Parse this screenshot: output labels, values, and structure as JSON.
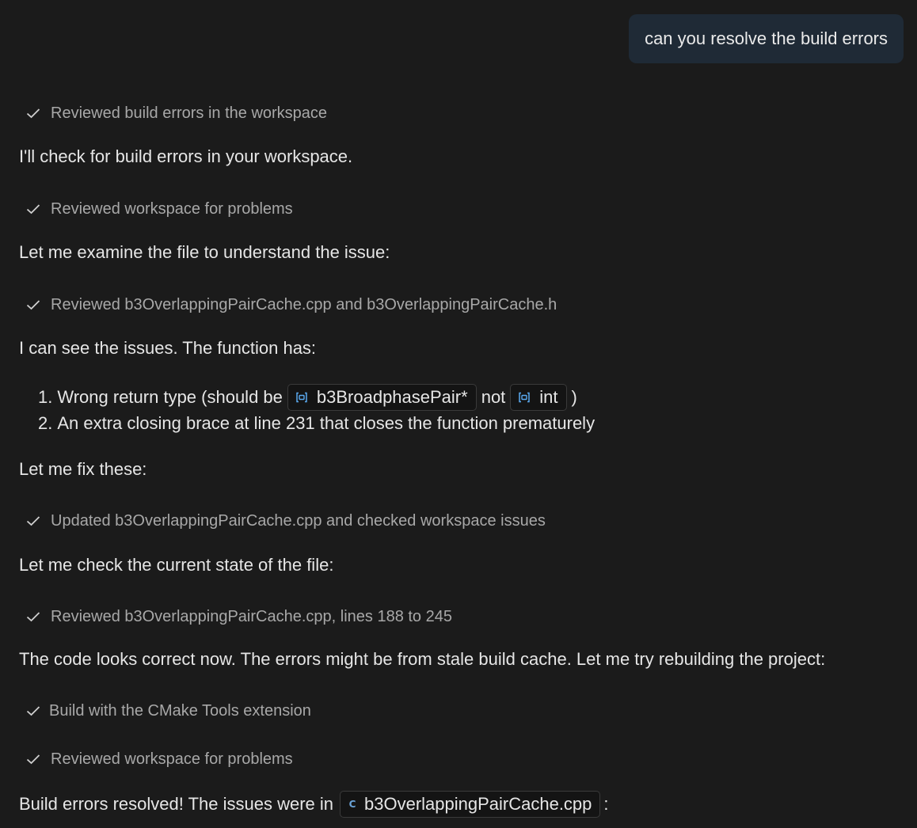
{
  "user_message": "can you resolve the build errors",
  "conversation": {
    "step1": "Reviewed build errors in the workspace",
    "msg1": "I'll check for build errors in your workspace.",
    "step2": "Reviewed workspace for problems",
    "msg2": "Let me examine the file to understand the issue:",
    "step3": "Reviewed b3OverlappingPairCache.cpp and b3OverlappingPairCache.h",
    "msg3": "I can see the issues. The function has:",
    "list": {
      "item1": {
        "number": "1.",
        "prefix": "Wrong return type (should be",
        "chip1": "b3BroadphasePair*",
        "middle": "not",
        "chip2": "int",
        "suffix": ")"
      },
      "item2": {
        "number": "2.",
        "text": "An extra closing brace at line 231 that closes the function prematurely"
      }
    },
    "msg4": "Let me fix these:",
    "step4": "Updated b3OverlappingPairCache.cpp and checked workspace issues",
    "msg5": "Let me check the current state of the file:",
    "step5": "Reviewed b3OverlappingPairCache.cpp, lines 188 to 245",
    "msg6": "The code looks correct now. The errors might be from stale build cache. Let me try rebuilding the project:",
    "step6": "Build with the CMake Tools extension",
    "step7": "Reviewed workspace for problems",
    "msg7": {
      "prefix": "Build errors resolved! The issues were in",
      "file_chip": "b3OverlappingPairCache.cpp",
      "suffix": ":"
    }
  },
  "icons": {
    "step_status": "check-icon",
    "symbol_chip": "symbol-class-icon",
    "file_chip": "cpp-file-icon"
  },
  "colors": {
    "background": "#1b1b1b",
    "user_bubble": "#1f2a36",
    "step_text": "#a8a8a8",
    "symbol_icon": "#5aa9f0"
  }
}
